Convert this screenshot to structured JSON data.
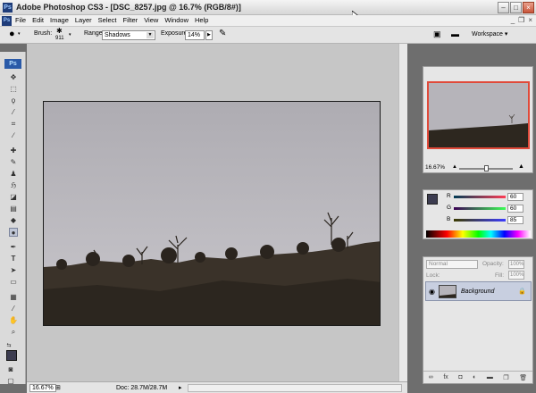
{
  "window": {
    "title": "Adobe Photoshop CS3 - [DSC_8257.jpg @ 16.7% (RGB/8#)]",
    "app_icon": "Ps"
  },
  "menu": [
    "File",
    "Edit",
    "Image",
    "Layer",
    "Select",
    "Filter",
    "View",
    "Window",
    "Help"
  ],
  "options": {
    "brush_label": "Brush:",
    "brush_size": "911",
    "range_label": "Range:",
    "range_value": "Shadows",
    "exposure_label": "Exposure:",
    "exposure_value": "14%",
    "workspace_label": "Workspace ▾"
  },
  "toolbox": {
    "logo": "Ps"
  },
  "status": {
    "zoom": "16.67%",
    "doc": "Doc: 28.7M/28.7M"
  },
  "navigator": {
    "zoom": "16.67%"
  },
  "color_panel": {
    "r_label": "R",
    "r_value": "60",
    "g_label": "G",
    "g_value": "60",
    "b_label": "B",
    "b_value": "85"
  },
  "layers_panel": {
    "blend_mode": "Normal",
    "opacity_label": "Opacity:",
    "opacity_value": "100%",
    "lock_label": "Lock:",
    "fill_label": "Fill:",
    "fill_value": "100%",
    "layer_name": "Background"
  }
}
